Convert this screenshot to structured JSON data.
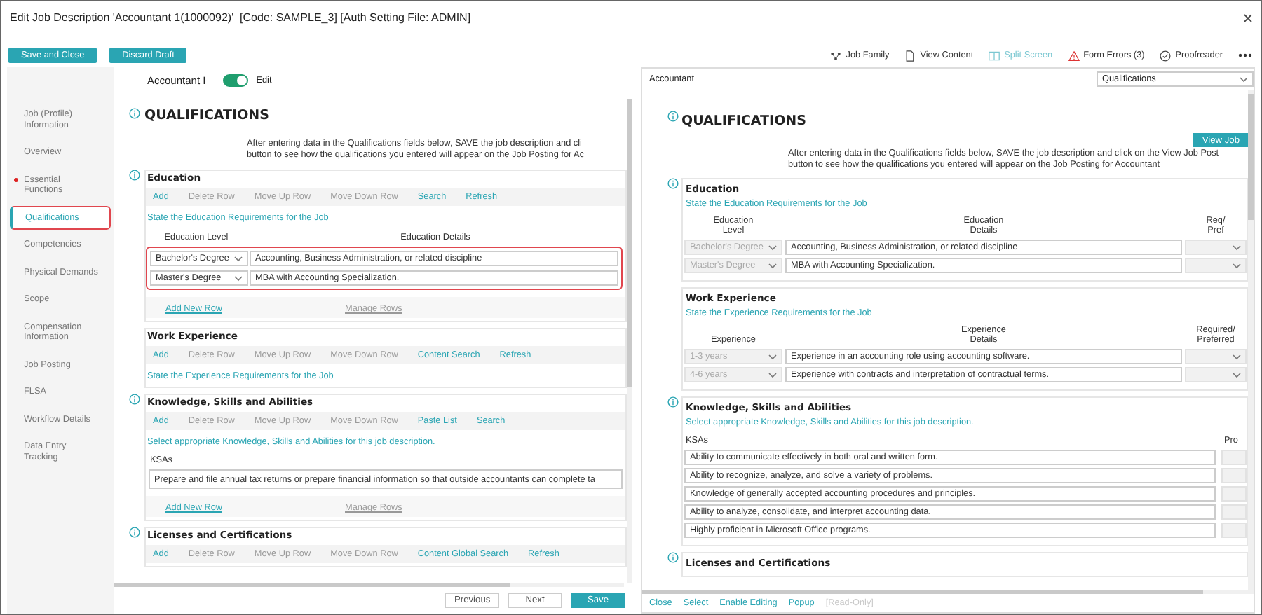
{
  "window": {
    "title": "Edit Job Description 'Accountant 1(1000092)'  [Code: SAMPLE_3] [Auth Setting File: ADMIN]"
  },
  "toolbar": {
    "buttons": [
      "Save and Close",
      "Discard Draft"
    ],
    "actions": [
      {
        "kind": "family",
        "label": "Job Family",
        "selected": false
      },
      {
        "kind": "content",
        "label": "View Content",
        "selected": false
      },
      {
        "kind": "split",
        "label": "Split Screen",
        "selected": true
      },
      {
        "kind": "errors",
        "label": "Form Errors (3)",
        "selected": false
      },
      {
        "kind": "proofread",
        "label": "Proofreader",
        "selected": false
      }
    ]
  },
  "sidebar": {
    "items": [
      {
        "label": "Job (Profile) Information",
        "selected": false,
        "error": false
      },
      {
        "label": "Overview",
        "selected": false,
        "error": false
      },
      {
        "label": "Essential Functions",
        "selected": false,
        "error": true
      },
      {
        "label": "Qualifications",
        "selected": true,
        "error": false
      },
      {
        "label": "Competencies",
        "selected": false,
        "error": false
      },
      {
        "label": "Physical Demands",
        "selected": false,
        "error": false
      },
      {
        "label": "Scope",
        "selected": false,
        "error": false
      },
      {
        "label": "Compensation Information",
        "selected": false,
        "error": false
      },
      {
        "label": "Job Posting",
        "selected": false,
        "error": false
      },
      {
        "label": "FLSA",
        "selected": false,
        "error": false
      },
      {
        "label": "Workflow Details",
        "selected": false,
        "error": false
      },
      {
        "label": "Data Entry Tracking",
        "selected": false,
        "error": false
      }
    ]
  },
  "editor": {
    "title": "Accountant I",
    "edit_toggle": {
      "label": "Edit",
      "on": true
    },
    "heading": "QUALIFICATIONS",
    "intro": [
      "After entering data in the Qualifications fields below, SAVE the job description and cli",
      "button to see how the qualifications you entered will appear on the Job Posting for Ac"
    ],
    "sections": [
      {
        "kind": "table",
        "title": "Education",
        "info": true,
        "tools": [
          {
            "label": "Add",
            "disabled": false
          },
          {
            "label": "Delete Row",
            "disabled": true
          },
          {
            "label": "Move Up Row",
            "disabled": true
          },
          {
            "label": "Move Down Row",
            "disabled": true
          },
          {
            "label": "Search",
            "disabled": false
          },
          {
            "label": "Refresh",
            "disabled": false
          }
        ],
        "instruction": "State the Education Requirements for the Job",
        "columns": [
          "Education Level",
          "Education Details"
        ],
        "rows": [
          {
            "level": "Bachelor's Degree",
            "details": "Accounting, Business Administration,  or related discipline"
          },
          {
            "level": "Master's Degree",
            "details": "MBA with Accounting Specialization."
          }
        ],
        "highlighted": true,
        "links": [
          {
            "label": "Add New Row",
            "disabled": false
          },
          {
            "label": "Manage Rows",
            "disabled": true
          }
        ]
      },
      {
        "kind": "plain",
        "title": "Work Experience",
        "info": false,
        "tools": [
          {
            "label": "Add",
            "disabled": false
          },
          {
            "label": "Delete Row",
            "disabled": true
          },
          {
            "label": "Move Up Row",
            "disabled": true
          },
          {
            "label": "Move Down Row",
            "disabled": true
          },
          {
            "label": "Content Search",
            "disabled": false
          },
          {
            "label": "Refresh",
            "disabled": false
          }
        ],
        "instruction": "State the Experience Requirements for the Job"
      },
      {
        "kind": "list",
        "title": "Knowledge, Skills and Abilities",
        "info": true,
        "tools": [
          {
            "label": "Add",
            "disabled": false
          },
          {
            "label": "Delete Row",
            "disabled": true
          },
          {
            "label": "Move Up Row",
            "disabled": true
          },
          {
            "label": "Move Down Row",
            "disabled": true
          },
          {
            "label": "Paste List",
            "disabled": false
          },
          {
            "label": "Search",
            "disabled": false
          }
        ],
        "instruction": "Select appropriate Knowledge, Skills and Abilities for this job description.",
        "label": "KSAs",
        "rows": [
          "Prepare and file annual tax returns or prepare financial information so that outside accountants can complete ta"
        ],
        "links": [
          {
            "label": "Add New Row",
            "disabled": false
          },
          {
            "label": "Manage Rows",
            "disabled": true
          }
        ]
      },
      {
        "kind": "plain",
        "title": "Licenses and Certifications",
        "info": true,
        "tools": [
          {
            "label": "Add",
            "disabled": false
          },
          {
            "label": "Delete Row",
            "disabled": true
          },
          {
            "label": "Move Up Row",
            "disabled": true
          },
          {
            "label": "Move Down Row",
            "disabled": true
          },
          {
            "label": "Content Global Search",
            "disabled": false
          },
          {
            "label": "Refresh",
            "disabled": false
          }
        ]
      }
    ],
    "buttons": [
      {
        "label": "Previous",
        "primary": false
      },
      {
        "label": "Next",
        "primary": false
      },
      {
        "label": "Save",
        "primary": true
      }
    ]
  },
  "preview": {
    "title": "Accountant",
    "section_select": "Qualifications",
    "heading": "QUALIFICATIONS",
    "view_button": "View Job",
    "intro": [
      "After entering data in the Qualifications fields below, SAVE the job description and click on the View Job Post",
      "button to see how the qualifications you entered will appear on the Job Posting for Accountant"
    ],
    "sections": [
      {
        "kind": "table",
        "title": "Education",
        "info": true,
        "instruction": "State the Education Requirements for the Job",
        "columns": [
          "Education Level",
          "Education Details",
          "Req/ Pref"
        ],
        "rows": [
          {
            "level": "Bachelor's Degree",
            "details": "Accounting, Business Administration,  or related discipline"
          },
          {
            "level": "Master's Degree",
            "details": "MBA with Accounting Specialization."
          }
        ]
      },
      {
        "kind": "table",
        "title": "Work Experience",
        "info": false,
        "instruction": "State the Experience Requirements for the Job",
        "columns": [
          "Experience",
          "Experience Details",
          "Required/ Preferred"
        ],
        "rows": [
          {
            "level": "1-3 years",
            "details": "Experience in an accounting role using accounting software."
          },
          {
            "level": "4-6 years",
            "details": "Experience with contracts and interpretation of contractual terms."
          }
        ]
      },
      {
        "kind": "list",
        "title": "Knowledge, Skills and Abilities",
        "info": true,
        "instruction": "Select appropriate Knowledge, Skills and Abilities for this job description.",
        "columns": [
          "KSAs",
          "Pro"
        ],
        "rows": [
          "Ability to communicate effectively in both oral and written form.",
          "Ability to recognize, analyze, and solve a variety of problems.",
          "Knowledge of generally accepted accounting procedures and principles.",
          "Ability to analyze, consolidate, and interpret accounting data.",
          "Highly proficient in Microsoft Office programs."
        ]
      },
      {
        "kind": "plain",
        "title": "Licenses and Certifications",
        "info": true
      }
    ],
    "links": [
      {
        "label": "Close",
        "disabled": false
      },
      {
        "label": "Select",
        "disabled": false
      },
      {
        "label": "Enable Editing",
        "disabled": false
      },
      {
        "label": "Popup",
        "disabled": false
      },
      {
        "label": "[Read-Only]",
        "disabled": true
      }
    ]
  }
}
